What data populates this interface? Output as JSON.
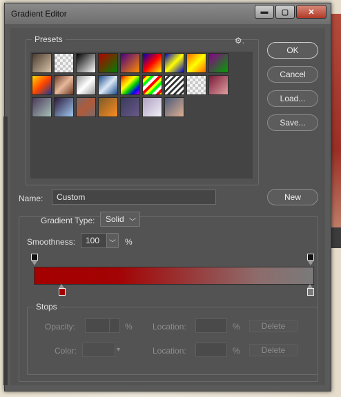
{
  "window": {
    "title": "Gradient Editor",
    "minimize": "▬",
    "maximize": "▢",
    "close": "✕"
  },
  "presets": {
    "label": "Presets",
    "gear": "⚙.",
    "swatches": [
      {
        "bg": "linear-gradient(135deg,#4a3b2f,#d7c3a8)"
      },
      {
        "bg": "repeating-conic-gradient(#c8c8c8 0% 25%, #f4f4f4 0% 50%) 0 0/8px 8px"
      },
      {
        "bg": "linear-gradient(135deg,#000,#fff)"
      },
      {
        "bg": "linear-gradient(135deg,#b40000,#008000)"
      },
      {
        "bg": "linear-gradient(135deg,#4b0082,#ff8c00)"
      },
      {
        "bg": "linear-gradient(135deg,#0000b4,#ff0000,#ffff00)"
      },
      {
        "bg": "linear-gradient(135deg,#0000cc,#ffff00,#0000cc)"
      },
      {
        "bg": "linear-gradient(135deg,#ff6600,#ffff00,#ff6600)"
      },
      {
        "bg": "linear-gradient(135deg,#8b008b,#00a000)"
      },
      {
        "bg": "linear-gradient(135deg,#ffd700,#ff4500,#1e3a8a)"
      },
      {
        "bg": "linear-gradient(135deg,#6b3a2a,#e8b89a,#6b3a2a)"
      },
      {
        "bg": "linear-gradient(135deg,#999,#fff,#999)"
      },
      {
        "bg": "linear-gradient(135deg,#1a4a8a,#dbe8f5,#1a4a8a)"
      },
      {
        "bg": "linear-gradient(135deg,#cc0000,#ff9900,#ffff00,#00cc00,#0000ff,#cc00cc)"
      },
      {
        "bg": "repeating-linear-gradient(135deg,#ff0000 0 4px,#ffff00 4px 8px,#00ff00 8px 12px,#fff 12px 16px)"
      },
      {
        "bg": "repeating-linear-gradient(135deg,#fff 0 3px,#333 3px 6px)"
      },
      {
        "bg": "repeating-conic-gradient(#c8c8c8 0% 25%, #f4f4f4 0% 50%) 0 0/8px 8px"
      },
      {
        "bg": "linear-gradient(135deg,#7a1a3a,#e0a0a0)"
      },
      {
        "bg": "linear-gradient(135deg,#4a3a5a,#a8c0b8)"
      },
      {
        "bg": "linear-gradient(135deg,#2a1a3a,#a0c8f0)"
      },
      {
        "bg": "linear-gradient(135deg,#7a6a6a,#b05a3a,#7a6a6a)"
      },
      {
        "bg": "linear-gradient(135deg,#7a5a2a,#ff8c20)"
      },
      {
        "bg": "linear-gradient(135deg,#3a3a5a,#6a5a8a)"
      },
      {
        "bg": "linear-gradient(135deg,#b0a0c0,#f0f0f8)"
      },
      {
        "bg": "linear-gradient(135deg,#4a5a7a,#e0b090)"
      }
    ]
  },
  "buttons": {
    "ok": "OK",
    "cancel": "Cancel",
    "load": "Load...",
    "save": "Save...",
    "new": "New"
  },
  "name": {
    "label": "Name:",
    "value": "Custom"
  },
  "gradient": {
    "type_label": "Gradient Type:",
    "type_value": "Solid",
    "smoothness_label": "Smoothness:",
    "smoothness_value": "100",
    "percent": "%",
    "stop_colors": {
      "left": "#a40000",
      "right": "#7a7a7a"
    }
  },
  "stops": {
    "label": "Stops",
    "opacity_label": "Opacity:",
    "opacity_unit": "%",
    "location_label": "Location:",
    "location_unit": "%",
    "delete_label": "Delete",
    "color_label": "Color:"
  }
}
